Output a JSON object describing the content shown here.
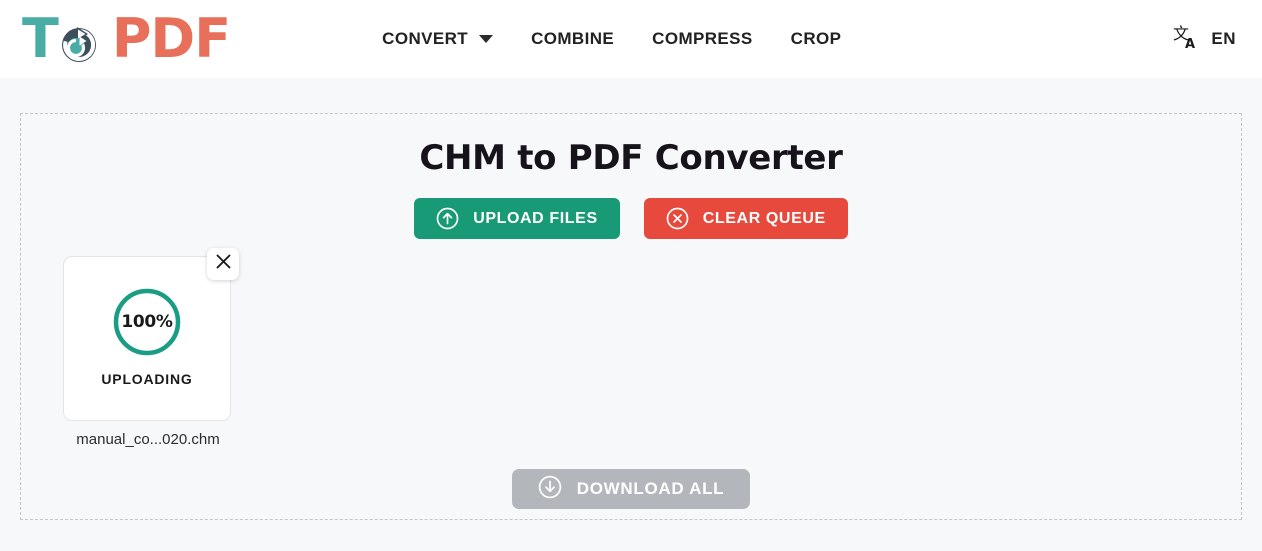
{
  "header": {
    "logo": {
      "text_primary": "T",
      "text_secondary": "PDF",
      "mark_icon": "refresh-circle-icon",
      "color_primary": "#4aada5",
      "color_secondary": "#e8705a"
    },
    "nav": [
      {
        "label": "CONVERT",
        "has_dropdown": true
      },
      {
        "label": "COMBINE",
        "has_dropdown": false
      },
      {
        "label": "COMPRESS",
        "has_dropdown": false
      },
      {
        "label": "CROP",
        "has_dropdown": false
      }
    ],
    "language": {
      "icon": "translate-icon",
      "code": "EN"
    }
  },
  "main": {
    "title": "CHM to PDF Converter",
    "upload_button": {
      "label": "UPLOAD FILES",
      "icon": "upload-circle-icon",
      "color": "#199a76"
    },
    "clear_button": {
      "label": "CLEAR QUEUE",
      "icon": "close-circle-icon",
      "color": "#e7493c"
    },
    "download_button": {
      "label": "DOWNLOAD ALL",
      "icon": "download-circle-icon",
      "color": "#b3b7bc",
      "disabled": true
    },
    "files": [
      {
        "name": "manual_co...020.chm",
        "progress": "100%",
        "status": "UPLOADING",
        "ring_color": "#1b9c85",
        "close_icon": "close-icon"
      }
    ]
  }
}
